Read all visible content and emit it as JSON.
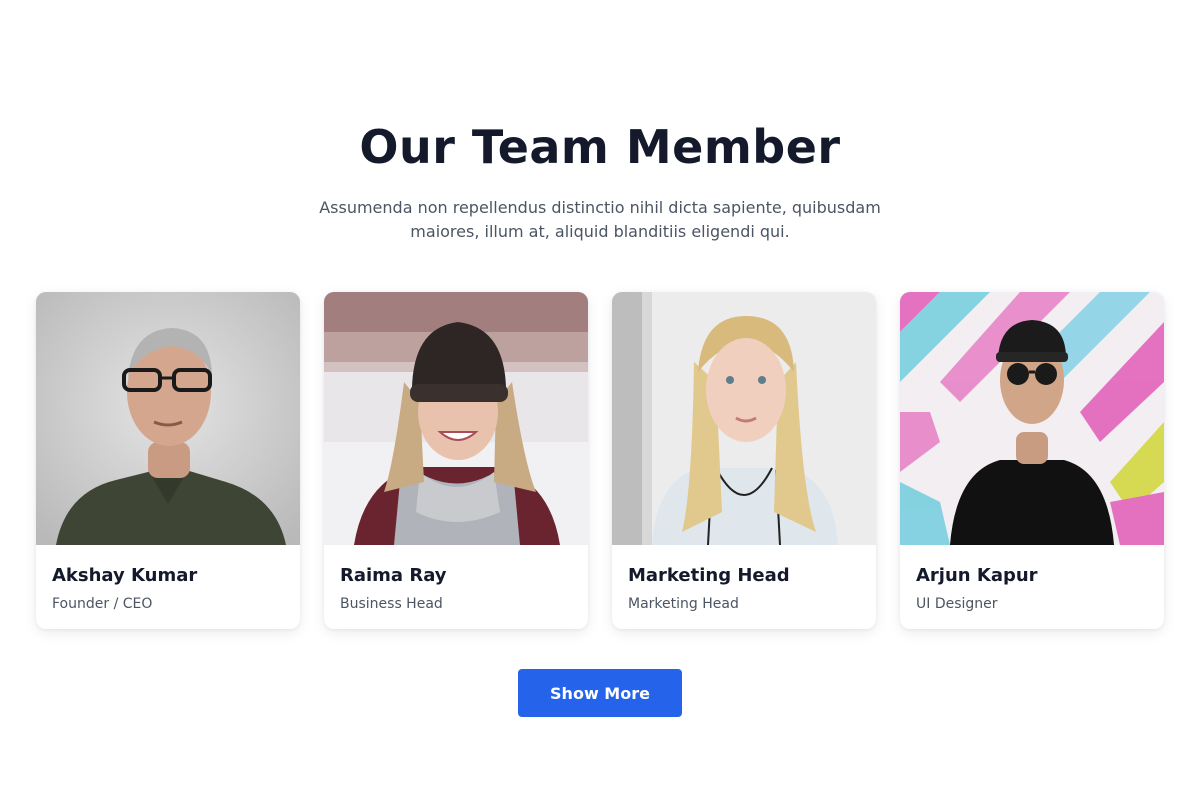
{
  "section": {
    "title": "Our Team Member",
    "subtitle": "Assumenda non repellendus distinctio nihil dicta sapiente, quibusdam maiores, illum at, aliquid blanditiis eligendi qui."
  },
  "members": [
    {
      "name": "Akshay Kumar",
      "role": "Founder / CEO",
      "photo": "man-with-glasses-photo"
    },
    {
      "name": "Raima Ray",
      "role": "Business Head",
      "photo": "woman-in-beanie-photo"
    },
    {
      "name": "Marketing Head",
      "role": "Marketing Head",
      "photo": "blonde-woman-photo"
    },
    {
      "name": "Arjun Kapur",
      "role": "UI Designer",
      "photo": "man-with-cap-photo"
    }
  ],
  "actions": {
    "show_more": "Show More"
  },
  "colors": {
    "accent": "#2563eb",
    "heading": "#141a2b",
    "body_text": "#4b5563"
  }
}
